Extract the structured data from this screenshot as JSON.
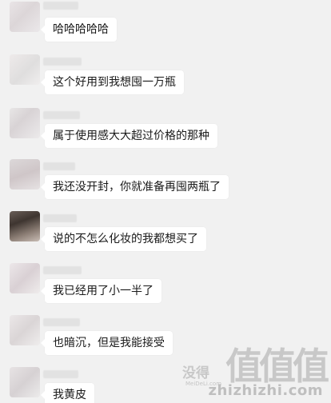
{
  "messages": [
    {
      "text": "哈哈哈哈哈"
    },
    {
      "text": "这个好用到我想囤一万瓶"
    },
    {
      "text": "属于使用感大大超过价格的那种"
    },
    {
      "text": "我还没开封，你就准备再囤两瓶了"
    },
    {
      "text": "说的不怎么化妆的我都想买了"
    },
    {
      "text": "我已经用了小一半了"
    },
    {
      "text": "也暗沉，但是我能接受"
    },
    {
      "text": "我黄皮"
    }
  ],
  "watermark": {
    "left_text": "没得",
    "small_text": "MeiDeLi.com",
    "main_text": "值值值",
    "url": "zhizhizhi.com"
  },
  "colors": {
    "background": "#f1f1f1",
    "bubble": "#ffffff",
    "text": "#1a1a1a"
  }
}
